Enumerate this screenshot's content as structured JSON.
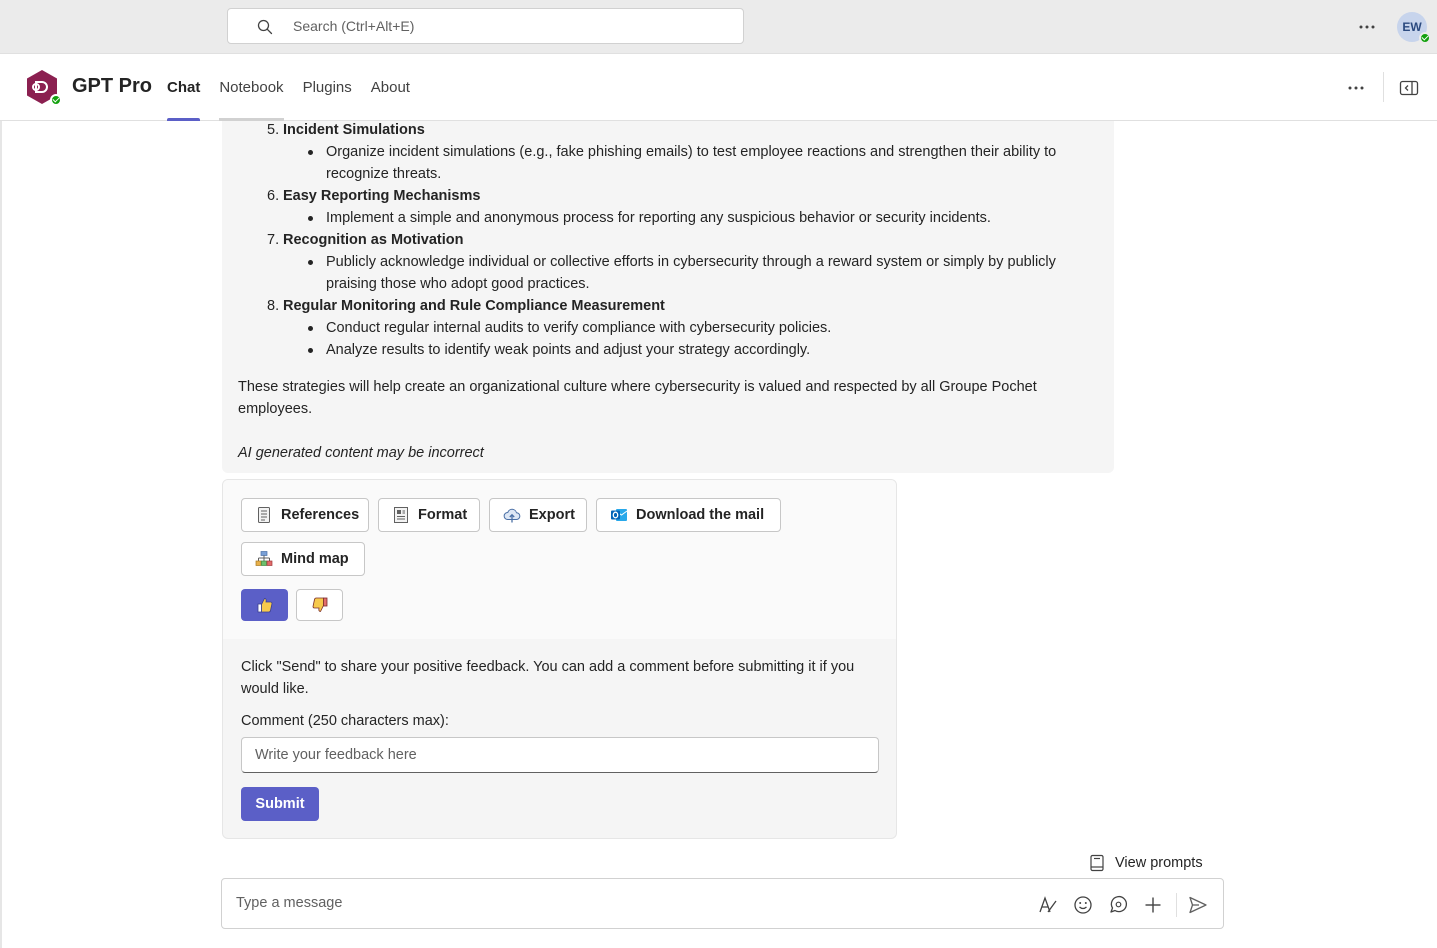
{
  "topbar": {
    "search_placeholder": "Search (Ctrl+Alt+E)",
    "avatar_initials": "EW",
    "more_icon": "more-horizontal-icon"
  },
  "app": {
    "title": "GPT Pro",
    "tabs": [
      {
        "label": "Chat",
        "active": true
      },
      {
        "label": "Notebook",
        "active": false
      },
      {
        "label": "Plugins",
        "active": false
      },
      {
        "label": "About",
        "active": false
      }
    ]
  },
  "message": {
    "items": [
      {
        "num": "5.",
        "title": "Incident Simulations",
        "bullets": [
          "Organize incident simulations (e.g., fake phishing emails) to test employee reactions and strengthen their ability to recognize threats."
        ]
      },
      {
        "num": "6.",
        "title": "Easy Reporting Mechanisms",
        "bullets": [
          "Implement a simple and anonymous process for reporting any suspicious behavior or security incidents."
        ]
      },
      {
        "num": "7.",
        "title": "Recognition as Motivation",
        "bullets": [
          "Publicly acknowledge individual or collective efforts in cybersecurity through a reward system or simply by publicly praising those who adopt good practices."
        ]
      },
      {
        "num": "8.",
        "title": "Regular Monitoring and Rule Compliance Measurement",
        "bullets": [
          "Conduct regular internal audits to verify compliance with cybersecurity policies.",
          "Analyze results to identify weak points and adjust your strategy accordingly."
        ]
      }
    ],
    "conclusion": "These strategies will help create an organizational culture where cybersecurity is valued and respected by all Groupe Pochet employees.",
    "disclaimer": "AI generated content may be incorrect"
  },
  "actions": {
    "references": "References",
    "format": "Format",
    "export": "Export",
    "download_mail": "Download the mail",
    "mind_map": "Mind map"
  },
  "feedback": {
    "message": "Click \"Send\" to share your positive feedback. You can add a comment before submitting it if you would like.",
    "comment_label": "Comment (250 characters max):",
    "comment_placeholder": "Write your feedback here",
    "submit_label": "Submit",
    "thumbs_up_selected": true
  },
  "compose": {
    "view_prompts": "View prompts",
    "placeholder": "Type a message"
  },
  "colors": {
    "accent": "#5b5fc7",
    "presence": "#13a10e",
    "logo": "#8b2050"
  }
}
